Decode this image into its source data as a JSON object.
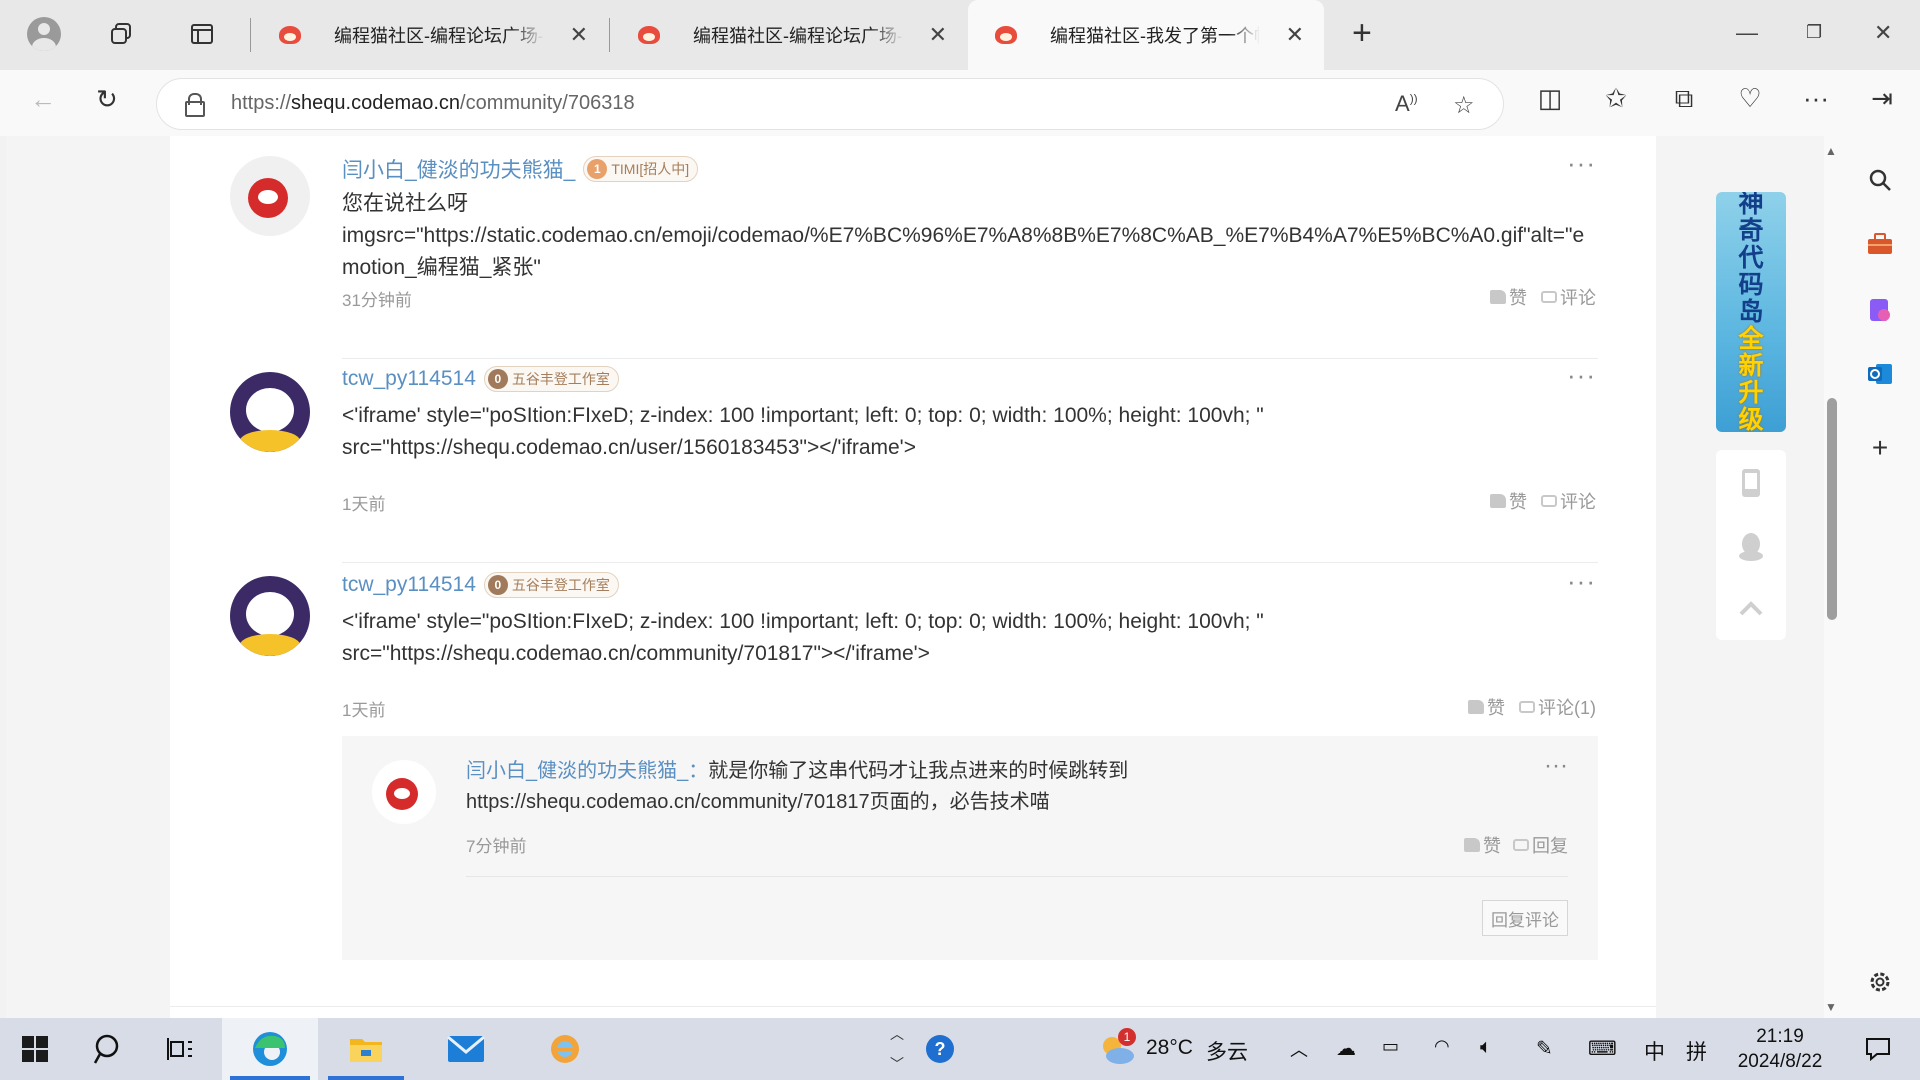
{
  "browser": {
    "tabs": [
      {
        "title": "编程猫社区-编程论坛广场-",
        "active": false
      },
      {
        "title": "编程猫社区-编程论坛广场-",
        "active": false
      },
      {
        "title": "编程猫社区-我发了第一个帖子",
        "active": true
      }
    ],
    "new_tab_label": "+",
    "url_prefix": "https://",
    "url_host": "shequ.codemao.cn",
    "url_path": "/community/706318"
  },
  "comments": [
    {
      "user": "闫小白_健淡的功夫熊猫_",
      "badge_level": "1",
      "badge_text": "TIMI[招人中]",
      "lines": [
        "您在说社么呀",
        "imgsrc=\"https://static.codemao.cn/emoji/codemao/%E7%BC%96%E7%A8%8B%E7%8C%AB_%E7%B4%A7%E5%BC%A0.gif\"alt=\"emotion_编程猫_紧张\""
      ],
      "time": "31分钟前",
      "like_label": "赞",
      "comment_label": "评论"
    },
    {
      "user": "tcw_py114514",
      "badge_level": "0",
      "badge_text": "五谷丰登工作室",
      "lines": [
        "<'iframe' style=\"poSItion:FIxeD; z-index: 100 !important; left: 0; top: 0; width: 100%; height: 100vh; \"",
        "src=\"https://shequ.codemao.cn/user/1560183453\"></'iframe'>"
      ],
      "time": "1天前",
      "like_label": "赞",
      "comment_label": "评论"
    },
    {
      "user": "tcw_py114514",
      "badge_level": "0",
      "badge_text": "五谷丰登工作室",
      "lines": [
        "<'iframe' style=\"poSItion:FIxeD; z-index: 100 !important; left: 0; top: 0; width: 100%; height: 100vh; \"",
        "src=\"https://shequ.codemao.cn/community/701817\"></'iframe'>"
      ],
      "time": "1天前",
      "like_label": "赞",
      "comment_label": "评论(1)"
    }
  ],
  "reply": {
    "user": "闫小白_健淡的功夫熊猫_",
    "separator": "：",
    "text_line1": "就是你输了这串代码才让我点进来的时候跳转到",
    "text_line2": "https://shequ.codemao.cn/community/701817页面的，必告技术喵",
    "time": "7分钟前",
    "like_label": "赞",
    "reply_label": "回复",
    "reply_comment_button": "回复评论"
  },
  "promo": {
    "line1": "神奇代码岛",
    "line2": "全新升级"
  },
  "taskbar": {
    "weather_temp": "28°C",
    "weather_desc": "多云",
    "weather_badge": "1",
    "ime_lang": "中",
    "ime_mode": "拼",
    "time": "21:19",
    "date": "2024/8/22"
  }
}
